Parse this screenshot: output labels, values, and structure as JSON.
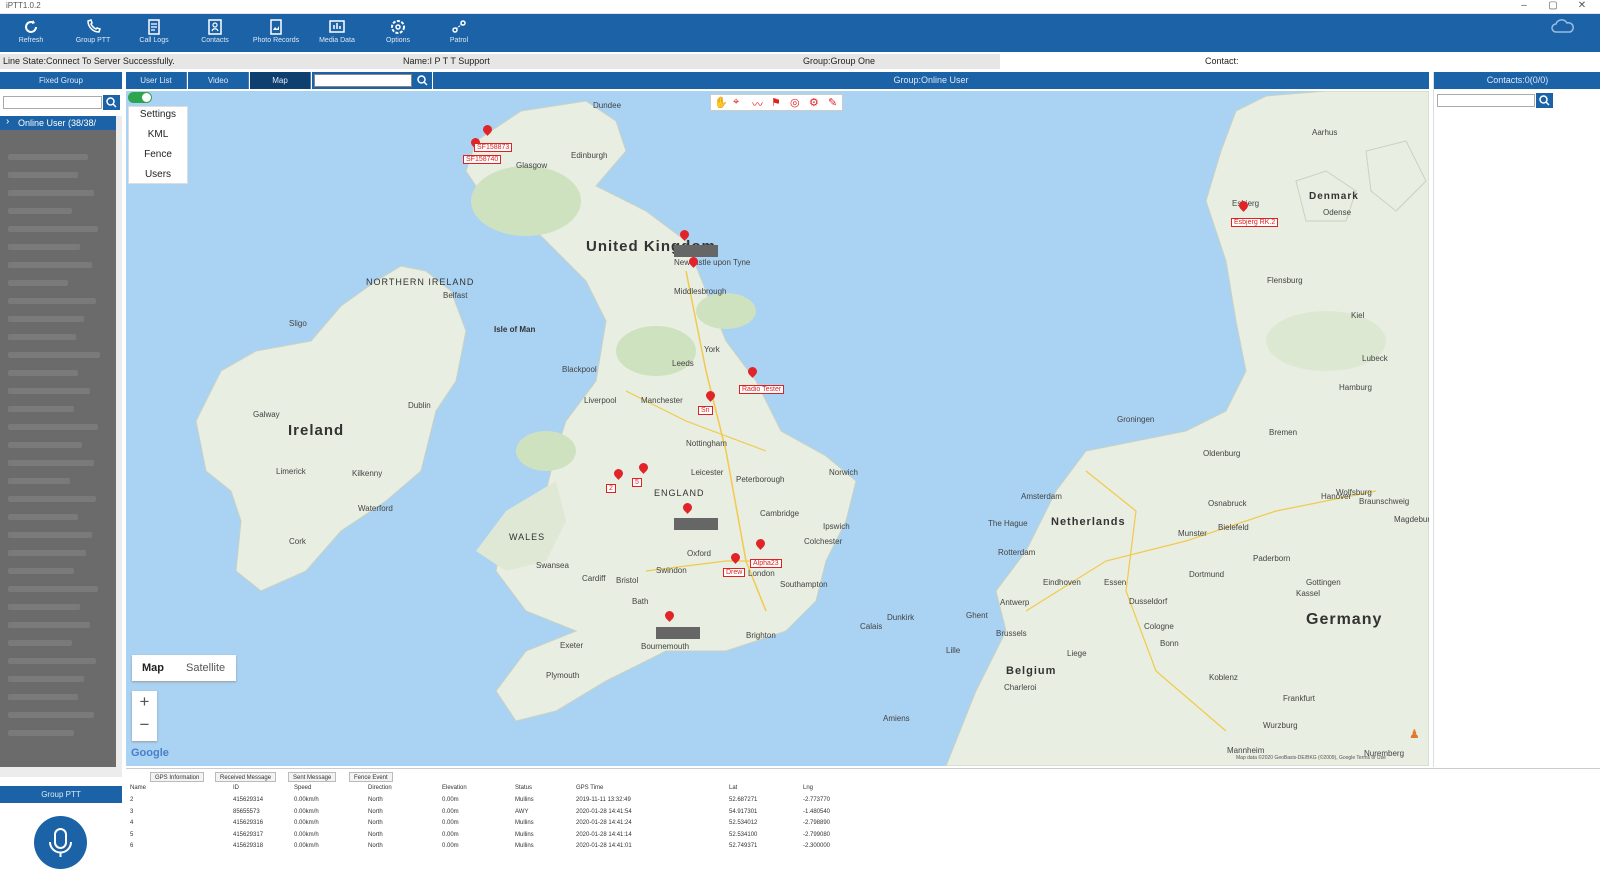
{
  "window": {
    "title": "iPTT1.0.2"
  },
  "toolbar": {
    "items": [
      {
        "label": "Refresh",
        "icon": "refresh-icon"
      },
      {
        "label": "Group PTT",
        "icon": "group-ptt-icon"
      },
      {
        "label": "Call Logs",
        "icon": "call-logs-icon"
      },
      {
        "label": "Contacts",
        "icon": "contacts-icon"
      },
      {
        "label": "Photo Records",
        "icon": "photo-records-icon"
      },
      {
        "label": "Media Data",
        "icon": "media-data-icon"
      },
      {
        "label": "Options",
        "icon": "gear-icon"
      },
      {
        "label": "Patrol",
        "icon": "patrol-icon"
      }
    ],
    "right_icon": "cloud-icon"
  },
  "status": {
    "line_state": "Line State:Connect To Server Successfully.",
    "name": "Name:I P T T Support",
    "group": "Group:Group One",
    "contact": "Contact:"
  },
  "left": {
    "fixed_group": "Fixed Group",
    "tree_header": "Online User (38/38/",
    "group_ptt": "Group PTT"
  },
  "tabs": [
    {
      "label": "User List",
      "active": false
    },
    {
      "label": "Video",
      "active": false
    },
    {
      "label": "Map",
      "active": true
    }
  ],
  "group_title": "Group:Online User",
  "contacts_title": "Contacts:0(0/0)",
  "map_menu": [
    "Settings",
    "KML",
    "Fence",
    "Users"
  ],
  "map_type": {
    "map": "Map",
    "satellite": "Satellite"
  },
  "map_labels": {
    "countries": [
      "United Kingdom",
      "Ireland",
      "Netherlands",
      "Belgium",
      "Germany",
      "Denmark"
    ],
    "regions": [
      "NORTHERN IRELAND",
      "ENGLAND",
      "WALES",
      "Isle of Man"
    ],
    "cities": [
      "Glasgow",
      "Edinburgh",
      "Dundee",
      "Newcastle upon Tyne",
      "Middlesbrough",
      "Leeds",
      "York",
      "Manchester",
      "Liverpool",
      "Blackpool",
      "Nottingham",
      "Leicester",
      "Peterborough",
      "Norwich",
      "Cambridge",
      "Ipswich",
      "Colchester",
      "Oxford",
      "London",
      "Swindon",
      "Cardiff",
      "Bristol",
      "Bath",
      "Swansea",
      "Southampton",
      "Bournemouth",
      "Brighton",
      "Plymouth",
      "Exeter",
      "Dublin",
      "Belfast",
      "Galway",
      "Limerick",
      "Cork",
      "Waterford",
      "Kilkenny",
      "Sligo",
      "Amsterdam",
      "The Hague",
      "Rotterdam",
      "Antwerp",
      "Brussels",
      "Ghent",
      "Cologne",
      "Dusseldorf",
      "Dortmund",
      "Bremen",
      "Hamburg",
      "Hanover",
      "Kiel",
      "Lubeck",
      "Frankfurt",
      "Odense",
      "Kassel",
      "Munster",
      "Essen",
      "Eindhoven",
      "Bielefeld",
      "Osnabruck",
      "Oldenburg",
      "Flensburg",
      "Esbjerg",
      "Aarhus",
      "Groningen",
      "Liege",
      "Charleroi",
      "Bonn",
      "Koblenz",
      "Wurzburg",
      "Mannheim",
      "Nuremberg",
      "Gottingen",
      "Paderborn",
      "Braunschweig",
      "Wolfsburg",
      "Magdeburg",
      "Amiens",
      "Calais",
      "Dunkirk",
      "Lille"
    ],
    "pin_tags": [
      "SF158873",
      "SF158740",
      "Radio Tester",
      "Sn",
      "2",
      "5",
      "Alpha23",
      "Drew",
      "Esbjerg RK.2"
    ],
    "google": "Google",
    "attribution": "Map data ©2020 GeoBasis-DE/BKG (©2009), Google  Terms of Use"
  },
  "bottom_tabs": [
    "GPS Information",
    "Received Message",
    "Sent Message",
    "Fence Event"
  ],
  "table": {
    "columns": [
      "Name",
      "ID",
      "Speed",
      "Direction",
      "Elevation",
      "Status",
      "GPS Time",
      "Lat",
      "Lng"
    ],
    "rows": [
      [
        "2",
        "415629314",
        "0.00km/h",
        "North",
        "0.00m",
        "Mullins",
        "2019-11-11 13:32:49",
        "52.687271",
        "-2.773770"
      ],
      [
        "3",
        "85655573",
        "0.00km/h",
        "North",
        "0.00m",
        "AWY",
        "2020-01-28 14:41:54",
        "54.917301",
        "-1.480540"
      ],
      [
        "4",
        "415629316",
        "0.00km/h",
        "North",
        "0.00m",
        "Mullins",
        "2020-01-28 14:41:24",
        "52.534012",
        "-2.798890"
      ],
      [
        "5",
        "415629317",
        "0.00km/h",
        "North",
        "0.00m",
        "Mullins",
        "2020-01-28 14:41:14",
        "52.534100",
        "-2.799080"
      ],
      [
        "6",
        "415629318",
        "0.00km/h",
        "North",
        "0.00m",
        "Mullins",
        "2020-01-28 14:41:01",
        "52.749371",
        "-2.300000"
      ]
    ]
  },
  "colors": {
    "toolbar": "#1b62a6",
    "map_sea": "#a9d2f3",
    "land": "#e8eee1",
    "pin": "#e0242a",
    "mic": "#1b62a6"
  }
}
